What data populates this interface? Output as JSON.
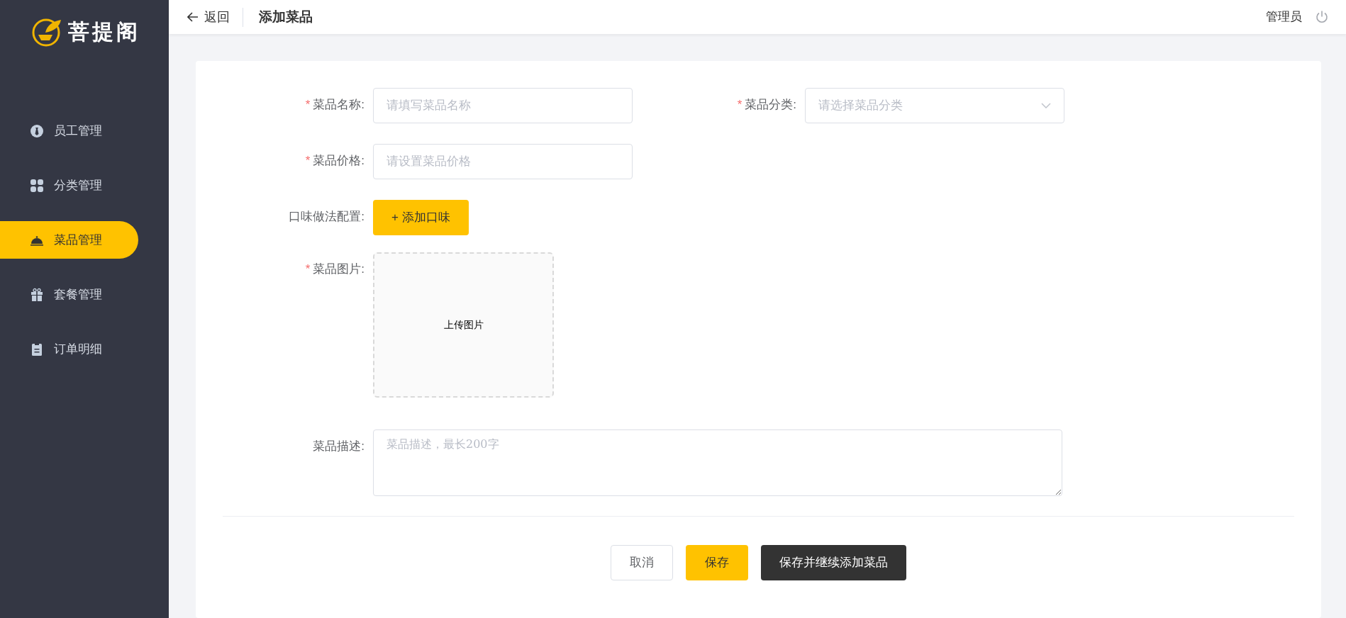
{
  "sidebar": {
    "logo": "菩提阁",
    "items": [
      {
        "label": "员工管理",
        "kind": "employee",
        "selected": false
      },
      {
        "label": "分类管理",
        "kind": "category",
        "selected": false
      },
      {
        "label": "菜品管理",
        "kind": "dish",
        "selected": true
      },
      {
        "label": "套餐管理",
        "kind": "combo",
        "selected": false
      },
      {
        "label": "订单明细",
        "kind": "order",
        "selected": false
      }
    ]
  },
  "header": {
    "back": "返回",
    "title": "添加菜品",
    "user": "管理员"
  },
  "form": {
    "fields": [
      {
        "kind": "input",
        "required_mark": "*",
        "label": "菜品名称:",
        "placeholder": "请填写菜品名称"
      },
      {
        "kind": "select",
        "required_mark": "*",
        "label": "菜品分类:",
        "placeholder": "请选择菜品分类"
      },
      {
        "kind": "input",
        "required_mark": "*",
        "label": "菜品价格:",
        "placeholder": "请设置菜品价格"
      },
      {
        "kind": "button",
        "label": "口味做法配置:",
        "button": "+ 添加口味"
      },
      {
        "kind": "upload",
        "required_mark": "*",
        "label": "菜品图片:",
        "text": "上传图片"
      },
      {
        "kind": "textarea",
        "label": "菜品描述:",
        "placeholder": "菜品描述，最长200字"
      }
    ],
    "actions": [
      {
        "label": "取消",
        "kind": "plain"
      },
      {
        "label": "保存",
        "kind": "primary"
      },
      {
        "label": "保存并继续添加菜品",
        "kind": "dark"
      }
    ]
  }
}
